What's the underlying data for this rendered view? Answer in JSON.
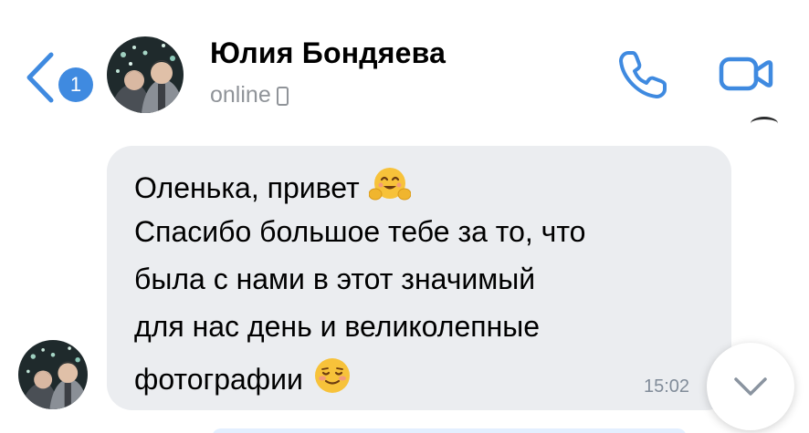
{
  "header": {
    "unread_count": "1",
    "contact_name": "Юлия Бондяева",
    "status": "online",
    "status_device_icon": "mobile-phone-icon",
    "call_icon": "phone-icon",
    "video_icon": "video-camera-icon"
  },
  "message": {
    "lines": [
      "Оленька, привет",
      "Спасибо большое тебе за то, что",
      "была с нами в этот значимый",
      "для нас день и великолепные",
      "фотографии"
    ],
    "time": "15:02",
    "emoji_hug": "hugging-face-emoji",
    "emoji_smile": "smiling-face-emoji"
  },
  "colors": {
    "accent": "#3f8ae0",
    "bubble_incoming": "#ebedf0",
    "secondary_text": "#909499"
  }
}
